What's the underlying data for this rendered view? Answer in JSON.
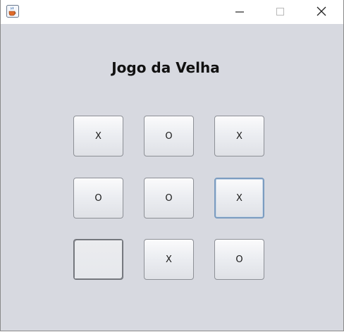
{
  "window": {
    "icon": "java-cup-icon",
    "controls": {
      "minimize": "minimize-icon",
      "maximize": "maximize-icon",
      "close": "close-icon"
    }
  },
  "game": {
    "title": "Jogo da Velha",
    "board": [
      [
        "X",
        "O",
        "X"
      ],
      [
        "O",
        "O",
        "X"
      ],
      [
        "",
        "X",
        "O"
      ]
    ]
  },
  "colors": {
    "background": "#d7d9e0",
    "focus_border": "#7b9cc0"
  }
}
